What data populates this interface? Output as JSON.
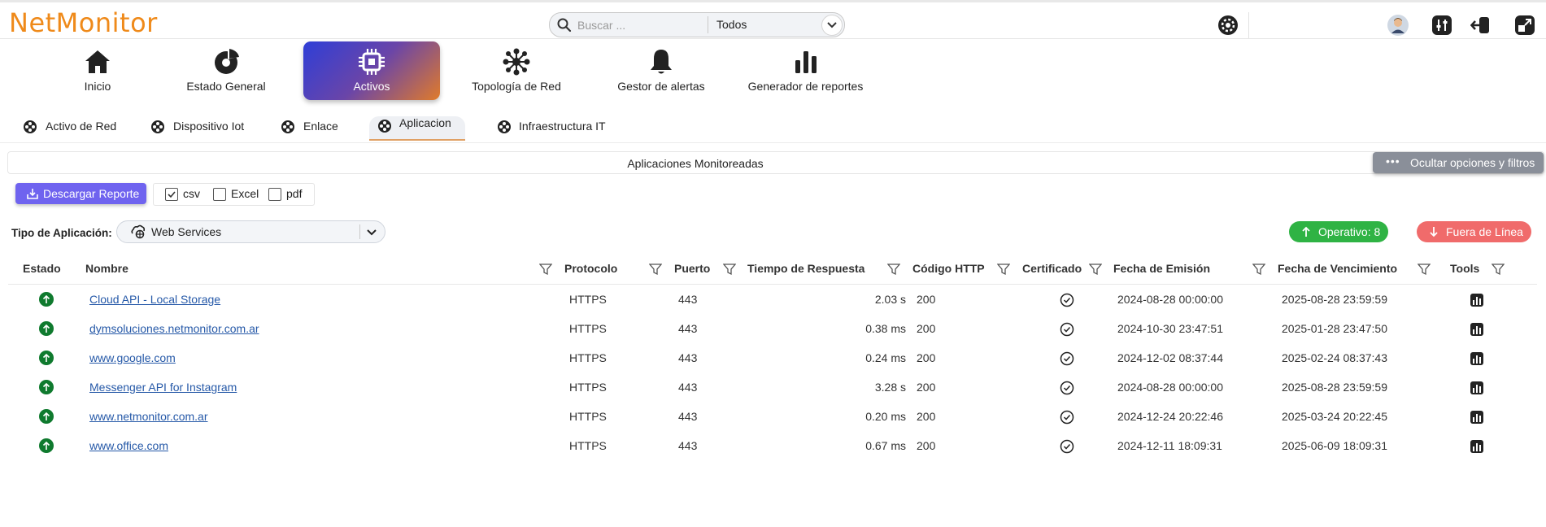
{
  "app": {
    "logo_text": "NetMonitor",
    "brand_color": "#ef8a1a"
  },
  "search": {
    "placeholder": "Buscar ...",
    "value": "",
    "scope_selected": "Todos"
  },
  "main_nav": {
    "items": [
      {
        "label": "Inicio",
        "icon": "home-icon"
      },
      {
        "label": "Estado General",
        "icon": "pie-chart-icon"
      },
      {
        "label": "Activos",
        "icon": "chip-icon",
        "active": true
      },
      {
        "label": "Topología de Red",
        "icon": "network-icon"
      },
      {
        "label": "Gestor de alertas",
        "icon": "bell-icon"
      },
      {
        "label": "Generador de reportes",
        "icon": "bar-chart-icon"
      }
    ]
  },
  "sub_tabs": [
    {
      "label": "Activo de Red"
    },
    {
      "label": "Dispositivo Iot"
    },
    {
      "label": "Enlace"
    },
    {
      "label": "Aplicacion",
      "active": true
    },
    {
      "label": "Infraestructura IT"
    }
  ],
  "section": {
    "title": "Aplicaciones Monitoreadas",
    "hide_filters_label": "Ocultar opciones y filtros"
  },
  "report": {
    "download_label": "Descargar Reporte",
    "formats": [
      {
        "label": "csv",
        "checked": true
      },
      {
        "label": "Excel",
        "checked": false
      },
      {
        "label": "pdf",
        "checked": false
      }
    ]
  },
  "filters": {
    "type_label": "Tipo de Aplicación:",
    "type_value": "Web Services",
    "operativo_label": "Operativo: 8",
    "fuera_label": "Fuera de Línea",
    "operativo_color": "#2fb344",
    "fuera_color": "#f06b6b"
  },
  "table": {
    "columns": [
      "Estado",
      "Nombre",
      "Protocolo",
      "Puerto",
      "Tiempo de Respuesta",
      "Código HTTP",
      "Certificado",
      "Fecha de Emisión",
      "Fecha de Vencimiento",
      "Tools"
    ],
    "rows": [
      {
        "nombre": "Cloud API - Local Storage",
        "protocolo": "HTTPS",
        "puerto": "443",
        "tiempo": "2.03 s",
        "codigo": "200",
        "emision": "2024-08-28 00:00:00",
        "vencimiento": "2025-08-28 23:59:59"
      },
      {
        "nombre": "dymsoluciones.netmonitor.com.ar",
        "protocolo": "HTTPS",
        "puerto": "443",
        "tiempo": "0.38 ms",
        "codigo": "200",
        "emision": "2024-10-30 23:47:51",
        "vencimiento": "2025-01-28 23:47:50"
      },
      {
        "nombre": "www.google.com",
        "protocolo": "HTTPS",
        "puerto": "443",
        "tiempo": "0.24 ms",
        "codigo": "200",
        "emision": "2024-12-02 08:37:44",
        "vencimiento": "2025-02-24 08:37:43"
      },
      {
        "nombre": "Messenger API for Instagram",
        "protocolo": "HTTPS",
        "puerto": "443",
        "tiempo": "3.28 s",
        "codigo": "200",
        "emision": "2024-08-28 00:00:00",
        "vencimiento": "2025-08-28 23:59:59"
      },
      {
        "nombre": "www.netmonitor.com.ar",
        "protocolo": "HTTPS",
        "puerto": "443",
        "tiempo": "0.20 ms",
        "codigo": "200",
        "emision": "2024-12-24 20:22:46",
        "vencimiento": "2025-03-24 20:22:45"
      },
      {
        "nombre": "www.office.com",
        "protocolo": "HTTPS",
        "puerto": "443",
        "tiempo": "0.67 ms",
        "codigo": "200",
        "emision": "2024-12-11 18:09:31",
        "vencimiento": "2025-06-09 18:09:31"
      }
    ]
  }
}
